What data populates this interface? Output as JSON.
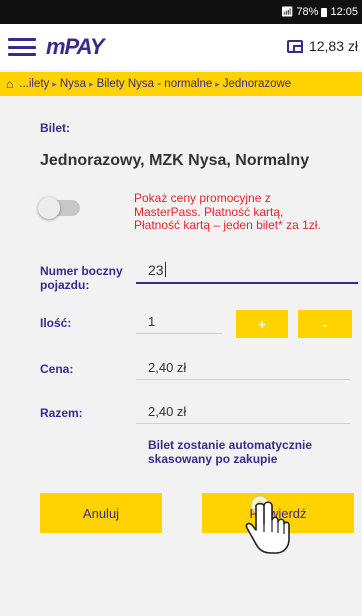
{
  "status_bar": {
    "battery": "78%",
    "time": "12:05"
  },
  "header": {
    "logo": "mPAY",
    "balance": "12,83 zł"
  },
  "breadcrumb": {
    "items": [
      "...ilety",
      "Nysa",
      "Bilety Nysa - normalne",
      "Jednorazowe"
    ]
  },
  "ticket": {
    "label": "Bilet:",
    "name": "Jednorazowy, MZK Nysa, Normalny"
  },
  "promo": {
    "line1": "Pokaż ceny promocyjne z",
    "line2": "MasterPass. Płatność kartą,",
    "line3": "Płatność kartą – jeden bilet* za 1zł.",
    "enabled": false
  },
  "form": {
    "vehicle_label_line1": "Numer boczny",
    "vehicle_label_line2": "pojazdu:",
    "vehicle_value": "23",
    "quantity_label": "Ilość:",
    "quantity_value": "1",
    "plus_label": "+",
    "minus_label": "-",
    "price_label": "Cena:",
    "price_value": "2,40 zł",
    "total_label": "Razem:",
    "total_value": "2,40 zł"
  },
  "notice": {
    "line1": "Bilet zostanie automatycznie",
    "line2": "skasowany po zakupie"
  },
  "actions": {
    "cancel_label": "Anuluj",
    "confirm_label": "Potwierdź"
  },
  "colors": {
    "brand_purple": "#3b2a8c",
    "brand_yellow": "#ffd200",
    "promo_red": "#e3262e"
  }
}
